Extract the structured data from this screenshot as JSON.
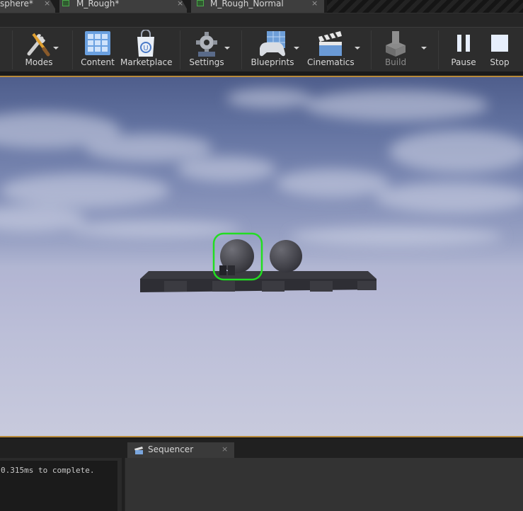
{
  "tabs": [
    {
      "label": "sphere*",
      "close": "×"
    },
    {
      "label": "M_Rough*",
      "close": "×"
    },
    {
      "label": "M_Rough_Normal",
      "close": "×"
    }
  ],
  "toolbar": {
    "modes": "Modes",
    "content": "Content",
    "marketplace": "Marketplace",
    "settings": "Settings",
    "blueprints": "Blueprints",
    "cinematics": "Cinematics",
    "build": "Build",
    "pause": "Pause",
    "stop": "Stop"
  },
  "bottom": {
    "sequencer_tab": "Sequencer",
    "sequencer_close": "×",
    "log_line": "0.315ms to complete."
  },
  "icons": [
    "modes-icon",
    "content-icon",
    "marketplace-icon",
    "settings-icon",
    "blueprints-icon",
    "cinematics-icon",
    "build-icon",
    "pause-icon",
    "stop-icon",
    "sequencer-icon"
  ],
  "colors": {
    "accent": "#b88a3a",
    "selection": "#22dd22"
  }
}
